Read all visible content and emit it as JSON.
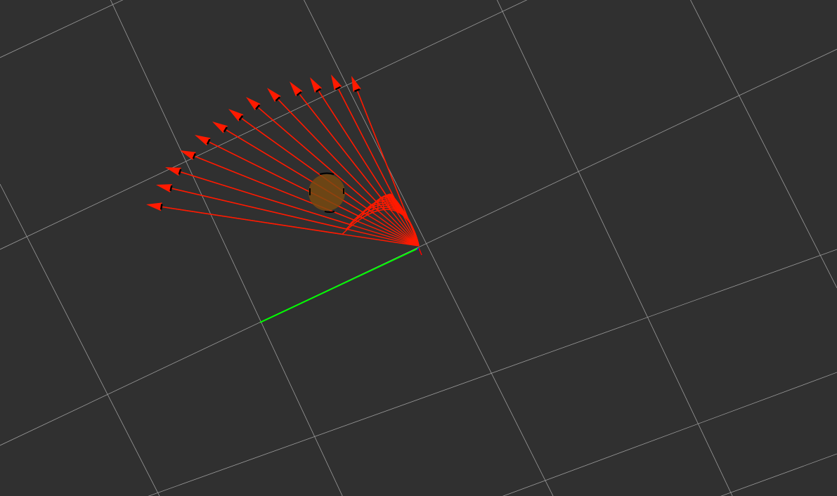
{
  "app": {
    "view": "3d-render-panel",
    "background_color": "#303030"
  },
  "scene": {
    "grid": {
      "visible": true,
      "color": "#9a9a9a"
    },
    "green_axis": {
      "visible": true,
      "color": "#00ff00"
    },
    "trajectory_arrows": {
      "count": 12,
      "color": "#ff1a00",
      "marker_color": "#000000"
    },
    "obstacle_sphere": {
      "visible": true,
      "color": "#7a4a10"
    },
    "origin_frame": {
      "visible": true,
      "colors": [
        "#0000ff",
        "#ff0000"
      ]
    }
  }
}
